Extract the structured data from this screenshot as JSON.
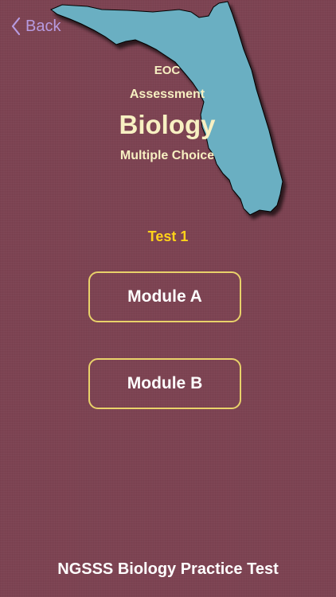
{
  "nav": {
    "back_label": "Back"
  },
  "header": {
    "line1": "EOC",
    "line2": "Assessment",
    "title": "Biology",
    "subtitle": "Multiple Choice"
  },
  "test": {
    "title": "Test 1"
  },
  "modules": [
    {
      "label": "Module A"
    },
    {
      "label": "Module B"
    }
  ],
  "footer": {
    "text": "NGSSS Biology Practice Test"
  },
  "colors": {
    "background": "#7d4352",
    "map_fill": "#6aafc2",
    "test_title": "#ffd21a",
    "button_border": "#e9d26a",
    "header_text": "#f7f0c2",
    "back_tint": "#b79be0"
  },
  "icons": {
    "back": "chevron-left-icon",
    "map": "florida-state-map"
  }
}
